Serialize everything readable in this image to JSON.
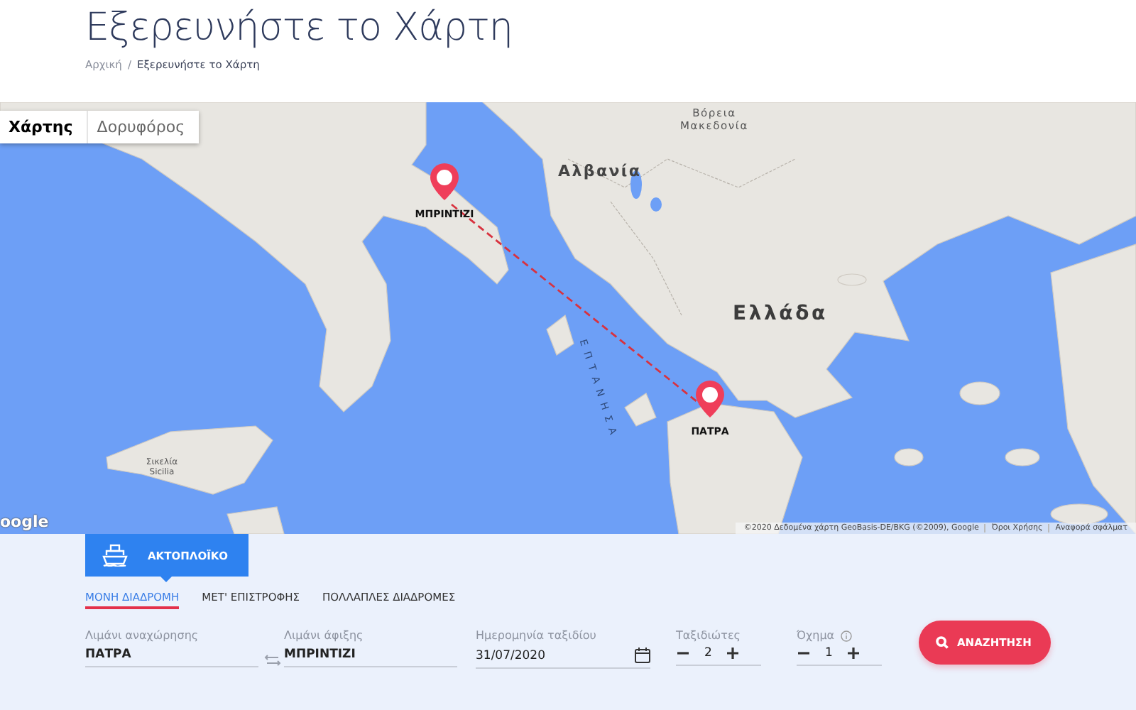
{
  "header": {
    "title": "Εξερευνήστε το Χάρτη",
    "breadcrumb": [
      {
        "label": "Αρχική"
      },
      {
        "label": "Εξερευνήστε το Χάρτη"
      }
    ],
    "separator": "/"
  },
  "map": {
    "map_types": [
      {
        "label": "Χάρτης",
        "selected": true
      },
      {
        "label": "Δορυφόρος",
        "selected": false
      }
    ],
    "labels": [
      {
        "text": "Βόρεια Μακεδονία",
        "kind": "country-small"
      },
      {
        "text": "Αλβανία",
        "kind": "country"
      },
      {
        "text": "Ελλάδα",
        "kind": "country-large"
      },
      {
        "text": "ΕΠΤΑΝΗΣΑ",
        "kind": "islands"
      },
      {
        "text": "Σικελία Sicilia",
        "kind": "region"
      }
    ],
    "ports": [
      {
        "name": "ΜΠΡΙΝΤΙΖΙ"
      },
      {
        "name": "ΠΑΤΡΑ"
      }
    ],
    "logo": "oogle",
    "attribution": [
      "©2020 Δεδομένα χάρτη GeoBasis-DE/BKG (©2009), Google",
      "Όροι Χρήσης",
      "Αναφορά σφάλματ"
    ]
  },
  "booking": {
    "modes": [
      {
        "label": "ΑΚΤΟΠΛΟΪΚΟ",
        "selected": true
      }
    ],
    "trip_types": [
      {
        "label": "ΜΟΝΗ ΔΙΑΔΡΟΜΗ",
        "selected": true
      },
      {
        "label": "ΜΕΤ' ΕΠΙΣΤΡΟΦΗΣ",
        "selected": false
      },
      {
        "label": "ΠΟΛΛΑΠΛΕΣ ΔΙΑΔΡΟΜΕΣ",
        "selected": false
      }
    ],
    "fields": [
      {
        "kind": "port",
        "label": "Λιμάνι αναχώρησης",
        "value": "ΠΑΤΡΑ"
      },
      {
        "kind": "port",
        "label": "Λιμάνι άφιξης",
        "value": "ΜΠΡΙΝΤΙΖΙ"
      },
      {
        "kind": "date",
        "label": "Ημερομηνία ταξιδίου",
        "value": "31/07/2020"
      },
      {
        "kind": "counter",
        "label": "Ταξιδιώτες",
        "value": "2",
        "info": false
      },
      {
        "kind": "counter",
        "label": "Όχημα",
        "value": "1",
        "info": true
      }
    ],
    "search_button": "ΑΝΑΖΗΤΗΣΗ"
  }
}
